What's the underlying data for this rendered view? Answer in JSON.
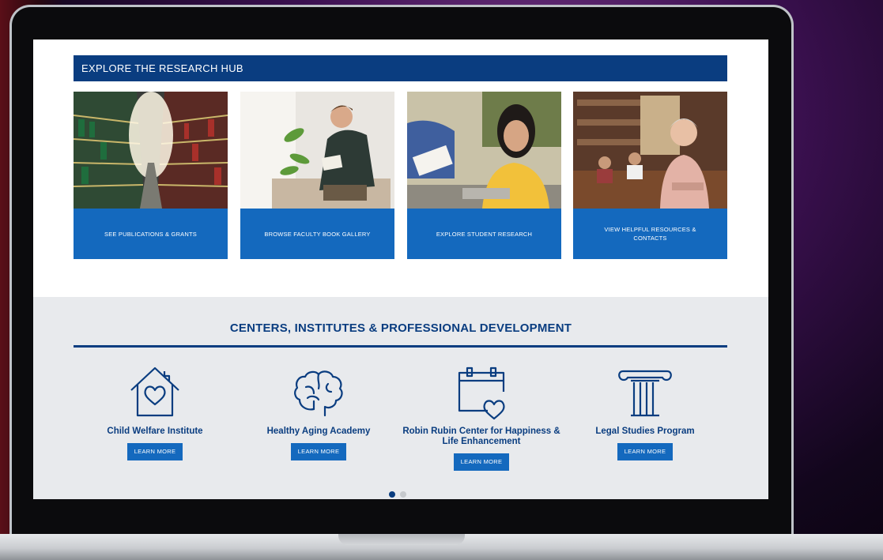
{
  "hub": {
    "header": "EXPLORE THE RESEARCH HUB",
    "cards": [
      {
        "label": "SEE PUBLICATIONS & GRANTS"
      },
      {
        "label": "BROWSE FACULTY BOOK GALLERY"
      },
      {
        "label": "EXPLORE STUDENT RESEARCH"
      },
      {
        "label": "VIEW HELPFUL RESOURCES & CONTACTS"
      }
    ]
  },
  "centers": {
    "title": "CENTERS, INSTITUTES & PROFESSIONAL DEVELOPMENT",
    "items": [
      {
        "name": "Child Welfare Institute",
        "button": "LEARN MORE",
        "icon": "house-heart-icon"
      },
      {
        "name": "Healthy Aging Academy",
        "button": "LEARN MORE",
        "icon": "brain-icon"
      },
      {
        "name": "Robin Rubin Center for Happiness & Life Enhancement",
        "button": "LEARN MORE",
        "icon": "calendar-heart-icon"
      },
      {
        "name": "Legal Studies Program",
        "button": "LEARN MORE",
        "icon": "column-icon"
      }
    ]
  },
  "carousel": {
    "pages": 2,
    "active": 1
  },
  "colors": {
    "navy": "#0a3d80",
    "blue": "#1469be",
    "gray_band": "#e8eaed"
  }
}
